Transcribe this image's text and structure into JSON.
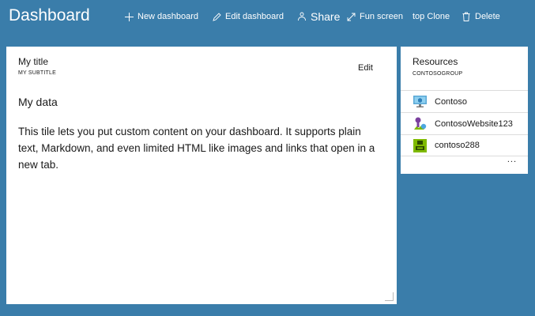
{
  "header": {
    "title": "Dashboard",
    "commands": [
      {
        "label": "New dashboard",
        "icon": "plus-icon"
      },
      {
        "label": "Edit dashboard",
        "icon": "pencil-icon"
      },
      {
        "label": "Share",
        "icon": "share-icon"
      },
      {
        "label": "Fun screen",
        "icon": "expand-icon"
      },
      {
        "label": "top Clone",
        "icon": ""
      },
      {
        "label": "Delete",
        "icon": "trash-icon"
      }
    ]
  },
  "markdown_tile": {
    "title": "My title",
    "subtitle": "MY SUBTITLE",
    "edit_label": "Edit",
    "heading": "My data",
    "body": "This tile lets you put custom content on your dashboard. It supports plain text, Markdown, and even limited HTML like images and links that open in a new tab."
  },
  "resources_tile": {
    "title": "Resources",
    "subtitle": "CONTOSOGROUP",
    "items": [
      {
        "name": "Contoso",
        "icon": "virtual-machine-icon"
      },
      {
        "name": "ContosoWebsite123",
        "icon": "website-icon"
      },
      {
        "name": "contoso288",
        "icon": "storage-icon"
      }
    ],
    "more_label": "..."
  },
  "colors": {
    "background": "#3a7daa",
    "tile": "#ffffff",
    "header_text": "#ffffff"
  }
}
